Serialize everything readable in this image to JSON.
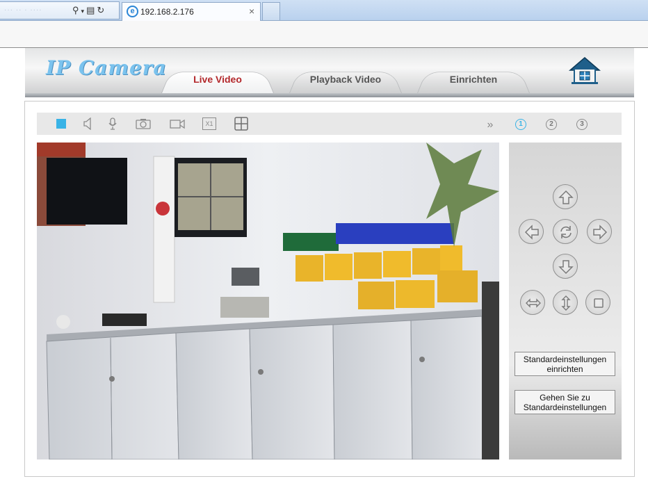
{
  "browser": {
    "tab_title": "192.168.2.176",
    "tab_close": "×",
    "address_faded": "··· ·· ·  ····",
    "icons": [
      "search-icon",
      "dropdown-icon",
      "compatibility-icon",
      "refresh-icon",
      "ie-icon",
      "close-icon"
    ]
  },
  "header": {
    "logo": "IP Camera",
    "tabs": [
      {
        "label": "Live Video",
        "active": true
      },
      {
        "label": "Playback Video",
        "active": false
      },
      {
        "label": "Einrichten",
        "active": false
      }
    ],
    "home_icon": "home-icon"
  },
  "toolbar": {
    "icons": [
      "play-stop-icon",
      "speaker-icon",
      "microphone-icon",
      "snapshot-camera-icon",
      "record-video-icon",
      "zoom-x1-icon",
      "grid-split-icon"
    ],
    "zoom_label": "X1",
    "more_icon": "double-chevron-right-icon",
    "streams": [
      "1",
      "2",
      "3"
    ],
    "active_stream": "1",
    "accent": "#39b3e6"
  },
  "ptz": {
    "buttons": [
      "up-arrow-icon",
      "left-arrow-icon",
      "rotate-icon",
      "right-arrow-icon",
      "down-arrow-icon",
      "horizontal-patrol-icon",
      "vertical-patrol-icon",
      "stop-icon"
    ],
    "preset_set": [
      "Standardeinstellungen",
      "einrichten"
    ],
    "preset_goto": [
      "Gehen Sie zu",
      "Standardeinstellungen"
    ]
  },
  "colors": {
    "active_tab_text": "#b3282b",
    "logo": "#7bc3ee"
  }
}
